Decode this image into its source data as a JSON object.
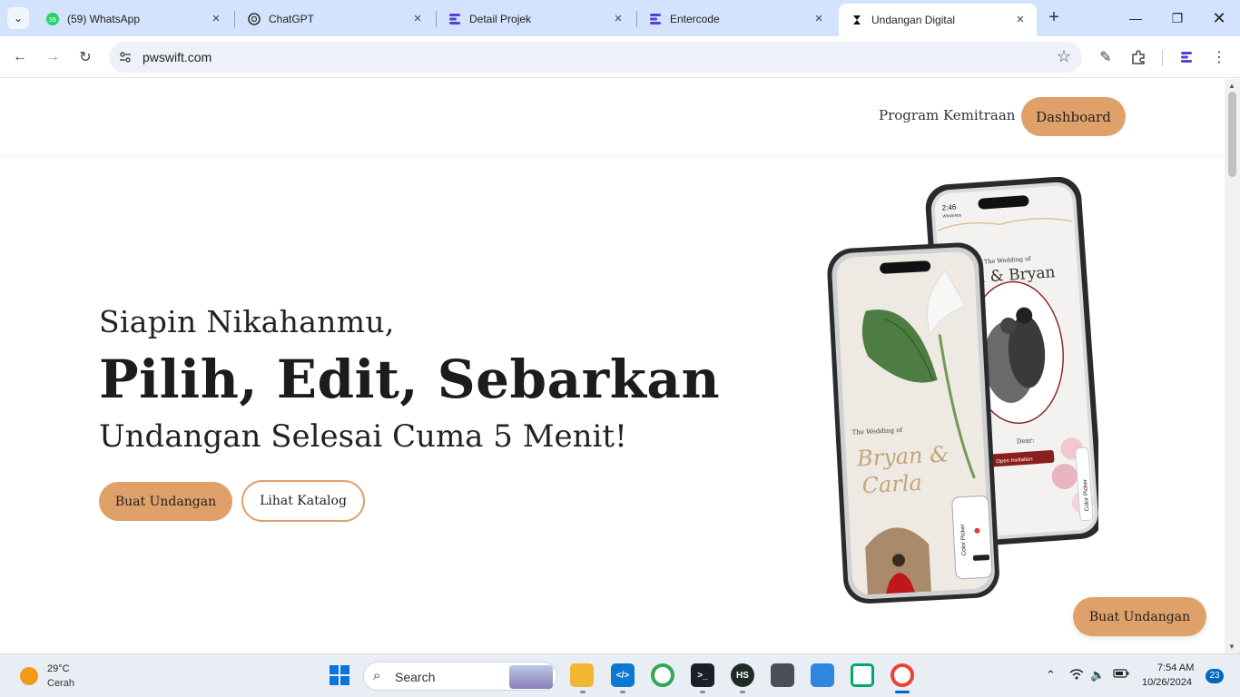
{
  "browser": {
    "tabs": [
      {
        "title": "(59) WhatsApp",
        "icon": "whatsapp-icon",
        "badge": "59"
      },
      {
        "title": "ChatGPT",
        "icon": "chatgpt-icon"
      },
      {
        "title": "Detail Projek",
        "icon": "entercode-icon"
      },
      {
        "title": "Entercode",
        "icon": "entercode-icon"
      },
      {
        "title": "Undangan Digital",
        "icon": "pwswift-icon",
        "active": true
      }
    ],
    "url": "pwswift.com"
  },
  "site": {
    "nav": {
      "program_link": "Program Kemitraan",
      "dashboard_button": "Dashboard"
    },
    "hero": {
      "line1": "Siapin Nikahanmu,",
      "line2": "Pilih, Edit, Sebarkan",
      "line3": "Undangan Selesai Cuma 5 Menit!",
      "primary_button": "Buat Undangan",
      "secondary_button": "Lihat Katalog"
    },
    "floating_button": "Buat Undangan",
    "phone_back": {
      "status_time": "2:46",
      "status_app": "WhatsApp",
      "wedding_of": "The Wedding of",
      "names": "a & Bryan",
      "dear": "Dear:",
      "open_button": "Open Invitation",
      "side_tab": "Color Picker"
    },
    "phone_front": {
      "wedding_of": "The Wedding of",
      "names_line1": "Bryan &",
      "names_line2": "Carla",
      "side_tab": "Color Picker"
    },
    "accent_color": "#e0a06a"
  },
  "taskbar": {
    "weather_temp": "29°C",
    "weather_desc": "Cerah",
    "search_label": "Search",
    "time": "7:54 AM",
    "date": "10/26/2024",
    "notification_count": "23"
  }
}
